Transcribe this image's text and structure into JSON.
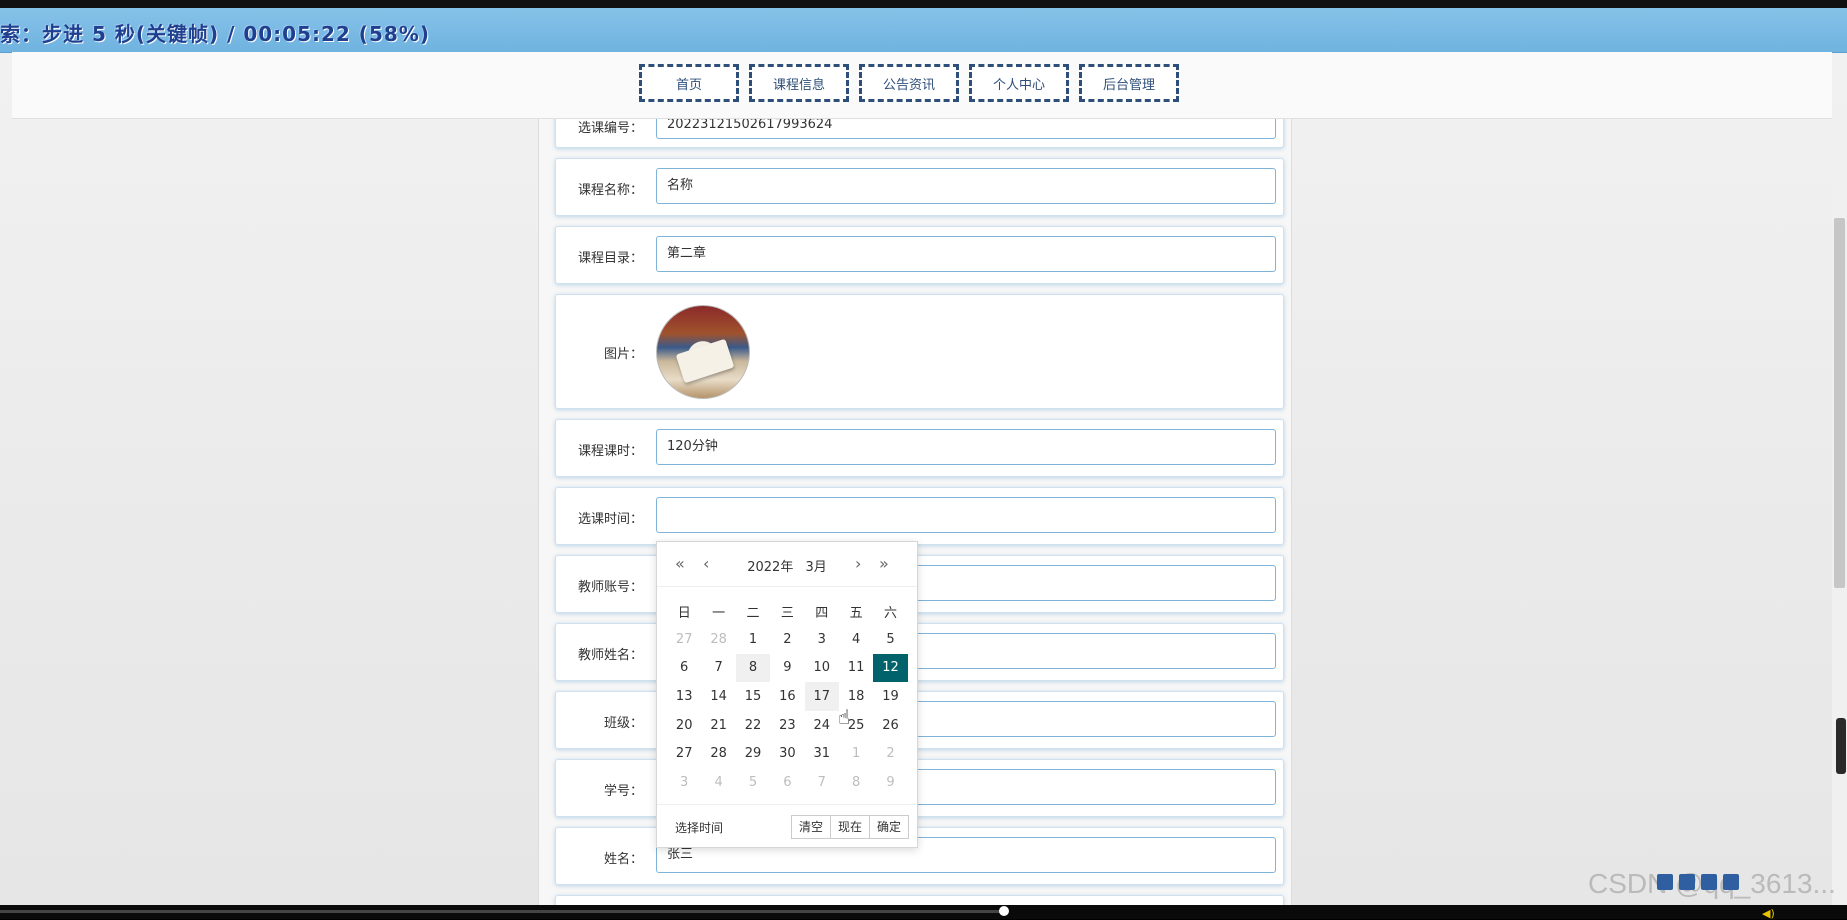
{
  "overlay": {
    "status_text": "索：步进 5 秒(关键帧) / 00:05:22 (58%)"
  },
  "nav": {
    "items": [
      "首页",
      "课程信息",
      "公告资讯",
      "个人中心",
      "后台管理"
    ]
  },
  "form": {
    "rows": [
      {
        "label": "选课编号：",
        "value": "202231215026179​93624"
      },
      {
        "label": "课程名称：",
        "value": "名称"
      },
      {
        "label": "课程目录：",
        "value": "第二章"
      },
      {
        "label": "图片：",
        "value": ""
      },
      {
        "label": "课程课时：",
        "value": "120分钟"
      },
      {
        "label": "选课时间：",
        "value": ""
      },
      {
        "label": "教师账号：",
        "value": ""
      },
      {
        "label": "教师姓名：",
        "value": ""
      },
      {
        "label": "班级：",
        "value": ""
      },
      {
        "label": "学号：",
        "value": ""
      },
      {
        "label": "姓名：",
        "value": "张三"
      }
    ]
  },
  "datepicker": {
    "year": "2022年",
    "month": "3月",
    "weekdays": [
      "日",
      "一",
      "二",
      "三",
      "四",
      "五",
      "六"
    ],
    "days": [
      [
        "27",
        "28",
        "1",
        "2",
        "3",
        "4",
        "5"
      ],
      [
        "6",
        "7",
        "8",
        "9",
        "10",
        "11",
        "12"
      ],
      [
        "13",
        "14",
        "15",
        "16",
        "17",
        "18",
        "19"
      ],
      [
        "20",
        "21",
        "22",
        "23",
        "24",
        "25",
        "26"
      ],
      [
        "27",
        "28",
        "29",
        "30",
        "31",
        "1",
        "2"
      ],
      [
        "3",
        "4",
        "5",
        "6",
        "7",
        "8",
        "9"
      ]
    ],
    "selected_day": "12",
    "footer_label": "选择时间",
    "buttons": [
      "清空",
      "现在",
      "确定"
    ]
  },
  "watermark": "CSDN @qq_3613...",
  "colors": {
    "accent": "#00636b",
    "nav_border": "#2e4f7a",
    "input_border": "#7fb3d8"
  }
}
